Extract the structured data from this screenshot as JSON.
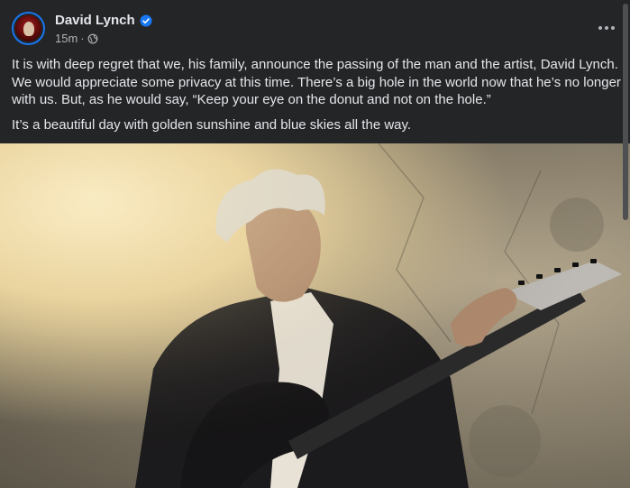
{
  "author": {
    "name": "David Lynch",
    "verified": true
  },
  "meta": {
    "time": "15m",
    "separator": "·",
    "audience_icon": "globe-icon"
  },
  "more_icon": "more-dots-icon",
  "post_text": [
    "It is with deep regret that we, his family, announce the passing of the man and the artist, David Lynch. We would appreciate some privacy at this time.  There’s a big hole in the world now that he’s no longer with us.  But, as he would say, “Keep your eye on the donut and not on the hole.”",
    "It’s a beautiful day with golden sunshine and blue skies all the way."
  ],
  "colors": {
    "background": "#242526",
    "text": "#e4e6eb",
    "secondary": "#b0b3b8",
    "verified": "#1877f2"
  }
}
